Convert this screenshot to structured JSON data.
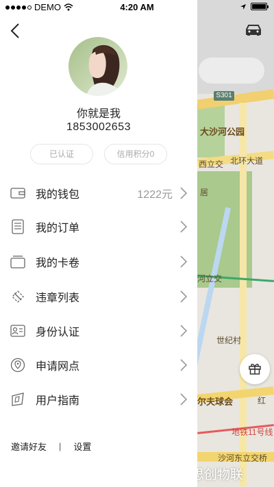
{
  "status_bar": {
    "carrier": "DEMO",
    "time": "4:20 AM"
  },
  "profile": {
    "name": "你就是我",
    "phone": "1853002653",
    "verified_badge": "已认证",
    "credit_badge": "信用积分0"
  },
  "menu": {
    "wallet": {
      "label": "我的钱包",
      "value": "1222元",
      "icon": "wallet-icon"
    },
    "orders": {
      "label": "我的订单",
      "icon": "order-list-icon"
    },
    "cards": {
      "label": "我的卡卷",
      "icon": "card-icon"
    },
    "violations": {
      "label": "违章列表",
      "icon": "violation-icon"
    },
    "identity": {
      "label": "身份认证",
      "icon": "id-card-icon"
    },
    "outlet": {
      "label": "申请网点",
      "icon": "location-pin-icon"
    },
    "guide": {
      "label": "用户指南",
      "icon": "guide-icon"
    }
  },
  "footer": {
    "invite": "邀请好友",
    "separator": "|",
    "settings": "设置"
  },
  "map": {
    "road_badge": "S301",
    "labels": {
      "park": "大沙河公园",
      "interchange_west": "西立交",
      "beihuan": "北环大道",
      "residence": "居",
      "interchange": "河立交",
      "world_trade": "世纪村",
      "golf": "尔夫球会",
      "red": "红",
      "metro": "地铁11号线",
      "shahe_east": "沙河东立交桥"
    }
  },
  "watermark": "头条号 / 思创物联",
  "colors": {
    "accent_text": "#222222",
    "muted": "#999999",
    "map_bg": "#e9e6df"
  }
}
